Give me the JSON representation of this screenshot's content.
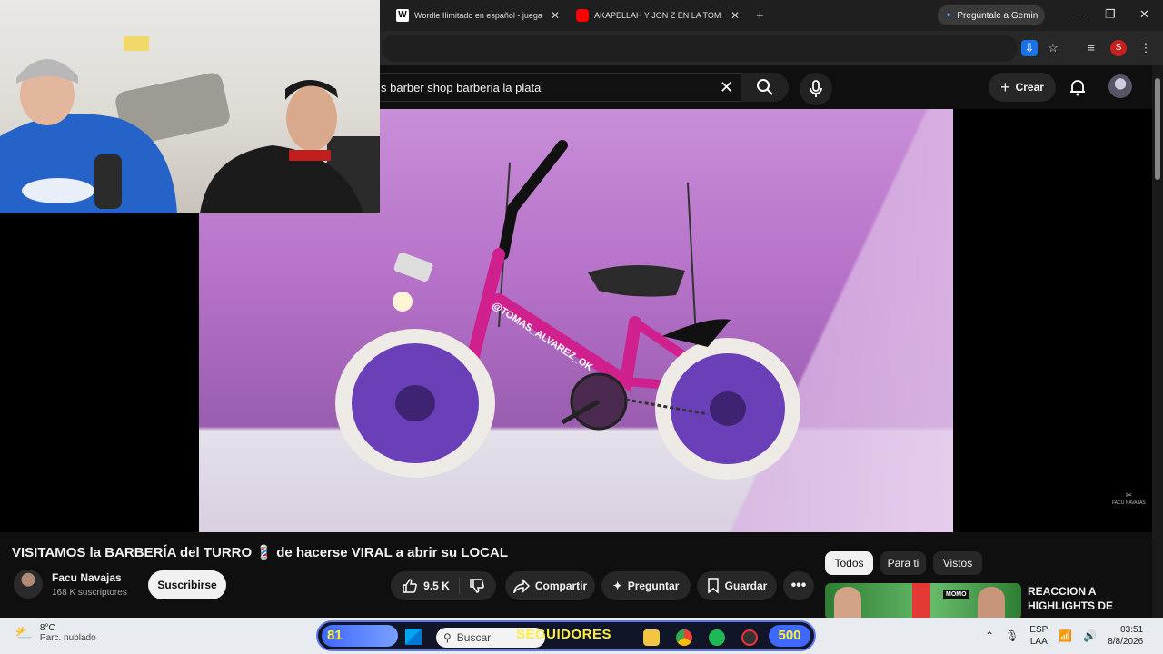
{
  "browser": {
    "tabs": [
      {
        "title": "Wordle Ilimitado en español - juega s",
        "close": "✕"
      },
      {
        "title": "AKAPELLAH Y JON Z EN LA TOM HOU",
        "close": "✕"
      }
    ],
    "new_tab": "+",
    "gemini_label": "Pregúntale a Gemini",
    "profile_initial": "S"
  },
  "youtube": {
    "search_query": "s barber shop barberia la plata",
    "create_label": "Crear",
    "video": {
      "title": "VISITAMOS la BARBERÍA del TURRO 💈 de hacerse VIRAL a abrir su LOCAL",
      "sticker_text": "@TOMAS_ALVAREZ_OK",
      "watermark": "FACU NAVAJAS"
    },
    "channel": {
      "name": "Facu Navajas",
      "subscribers": "168 K suscriptores",
      "subscribe_label": "Suscribirse"
    },
    "actions": {
      "likes": "9.5 K",
      "share": "Compartir",
      "ask": "Preguntar",
      "save": "Guardar"
    },
    "chips": [
      "Todos",
      "Para ti",
      "Vistos"
    ],
    "suggestion": {
      "title": "REACCION A HIGHLIGHTS DE",
      "badge": "MOMO"
    }
  },
  "taskbar": {
    "weather_temp": "8°C",
    "weather_desc": "Parc. nublado",
    "search_label": "Buscar",
    "followers_current": "81",
    "followers_label": "SEGUIDORES",
    "followers_goal": "500",
    "lang_top": "ESP",
    "lang_bottom": "LAA",
    "time": "03:51",
    "date": "8/8/2026"
  },
  "colors": {
    "accent_blue": "#3f68ff",
    "overlay_yellow": "#ffef3d",
    "bike_pink": "#d0208e",
    "wheel_purple": "#6a3fb8"
  }
}
